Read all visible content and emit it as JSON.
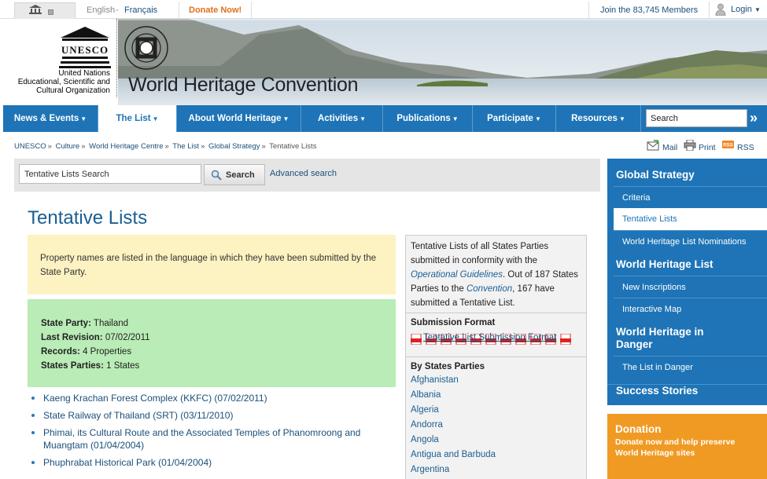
{
  "topbar": {
    "lang_en": "English",
    "lang_sep": "-",
    "lang_fr": "Français",
    "donate": "Donate Now!",
    "join": "Join the 83,745 Members",
    "login": "Login"
  },
  "header": {
    "org_name_1": "United Nations",
    "org_name_2": "Educational, Scientific and",
    "org_name_3": "Cultural Organization",
    "site_title": "World Heritage Convention"
  },
  "nav": {
    "items": [
      {
        "label": "News & Events"
      },
      {
        "label": "The List"
      },
      {
        "label": "About World Heritage"
      },
      {
        "label": "Activities"
      },
      {
        "label": "Publications"
      },
      {
        "label": "Participate"
      },
      {
        "label": "Resources"
      }
    ],
    "search_value": "Search"
  },
  "breadcrumb": [
    "UNESCO",
    "Culture",
    "World Heritage Centre",
    "The List",
    "Global Strategy",
    "Tentative Lists"
  ],
  "tools": {
    "mail": "Mail",
    "print": "Print",
    "rss": "RSS"
  },
  "search": {
    "value": "Tentative Lists Search",
    "button": "Search",
    "advanced": "Advanced search"
  },
  "page": {
    "title": "Tentative Lists",
    "notice": "Property names are listed in the language in which they have been submitted by the State Party.",
    "info": {
      "state_party_label": "State Party:",
      "state_party": "Thailand",
      "last_revision_label": "Last Revision:",
      "last_revision": "07/02/2011",
      "records_label": "Records:",
      "records": "4 Properties",
      "states_parties_label": "States Parties:",
      "states_parties": "1 States"
    },
    "properties": [
      "Kaeng Krachan Forest Complex (KKFC) (07/02/2011)",
      "State Railway of Thailand (SRT) (03/11/2010)",
      "Phimai, its Cultural Route and the Associated Temples of Phanomroong and Muangtam (01/04/2004)",
      "Phuphrabat Historical Park (01/04/2004)"
    ]
  },
  "aside": {
    "intro_1": "Tentative Lists of all States Parties submitted in conformity with the",
    "intro_link_1": "Operational Guidelines",
    "intro_2": ". Out of 187 States Parties to the",
    "intro_link_2": "Convention",
    "intro_3": ", 167 have submitted a Tentative List.",
    "submission_head": "Submission Format",
    "submission_link": "Tentative List Submission Format",
    "by_states_head": "By States Parties",
    "states": [
      "Afghanistan",
      "Albania",
      "Algeria",
      "Andorra",
      "Angola",
      "Antigua and Barbuda",
      "Argentina"
    ]
  },
  "sidebar": {
    "global_strategy": "Global Strategy",
    "criteria": "Criteria",
    "tentative_lists": "Tentative Lists",
    "nominations": "World Heritage List Nominations",
    "whl": "World Heritage List",
    "new_inscriptions": "New Inscriptions",
    "interactive_map": "Interactive Map",
    "in_danger_1": "World Heritage in",
    "in_danger_2": "Danger",
    "list_in_danger": "The List in Danger",
    "success_stories": "Success Stories"
  },
  "donate_box": {
    "title": "Donation",
    "text": "Donate now and help preserve World Heritage sites"
  },
  "colors": {
    "nav_blue": "#1e74b6",
    "title_blue": "#1a5f93",
    "notice_yellow": "#fdf2c1",
    "info_green": "#b9ecb6",
    "donate_orange": "#f09a24"
  }
}
